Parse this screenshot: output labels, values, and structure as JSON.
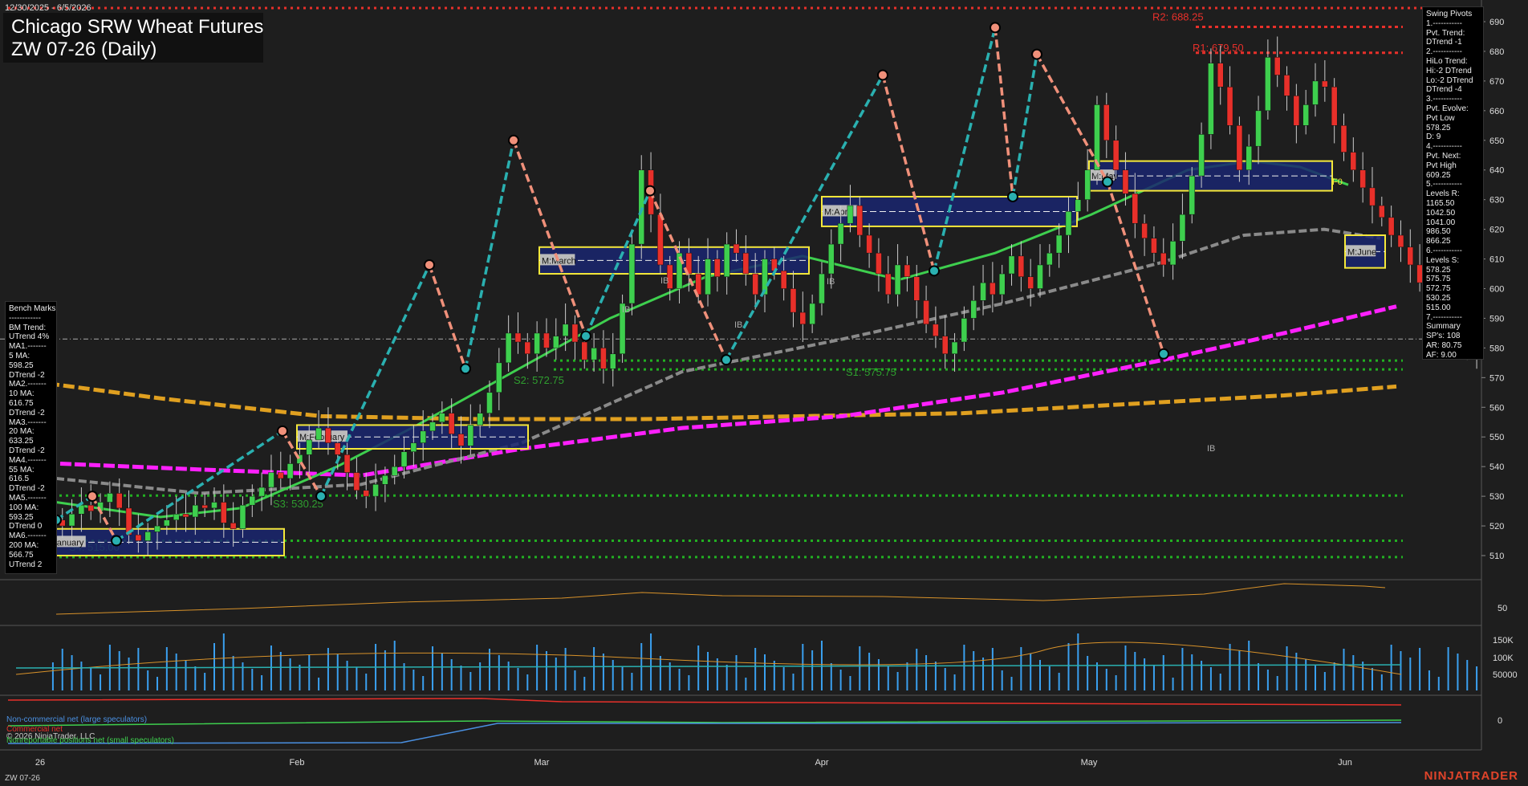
{
  "header": {
    "date_range": "12/30/2025 - 6/5/2026",
    "title": "Chicago SRW Wheat Futures",
    "subtitle": "ZW 07-26 (Daily)"
  },
  "bench_marks": {
    "text": "Bench Marks\n------------\nBM Trend:\nUTrend 4%\nMA1.-------\n5 MA:\n598.25\nDTrend -2\nMA2.-------\n10 MA:\n616.75\nDTrend -2\nMA3.-------\n20 MA:\n633.25\nDTrend -2\nMA4.-------\n55 MA:\n616.5\nDTrend -2\nMA5.-------\n100 MA:\n593.25\nDTrend 0\nMA6.-------\n200 MA:\n566.75\nUTrend 2"
  },
  "swing_pivots": {
    "text": "Swing Pivots\n1.-----------\nPvt. Trend:\nDTrend -1\n2.-----------\nHiLo Trend:\nHi:-2 DTrend\nLo:-2 DTrend\nDTrend -4\n3.-----------\nPvt. Evolve:\nPvt Low\n578.25\nD: 9\n4.-----------\nPvt. Next:\nPvt High\n609.25\n5.-----------\nLevels R:\n1165.50\n1042.50\n1041.00\n986.50\n866.25\n6.-----------\nLevels S:\n578.25\n575.75\n572.75\n530.25\n515.00\n7.-----------\nSummary\nSP's: 108\nAR: 80.75\nAF: 9.00"
  },
  "legend": {
    "noncommercial": "Non-commercial net (large speculators)",
    "commercial": "Commercial net",
    "copyright": "© 2026 NinjaTrader, LLC",
    "nonreportable": "Nonreportable positions net (small speculators)"
  },
  "footer": {
    "symbol": "ZW 07-26",
    "brand": "NINJATRADER"
  },
  "colors": {
    "up": "#3ecf4e",
    "down": "#e8302a",
    "ma_fast": "#3ecf4e",
    "ma_mid": "#8a8a8a",
    "ma_slow": "#ff20ff",
    "ma_200": "#e0a020",
    "swing_up": "#2ab0b0",
    "swing_down": "#f0907a",
    "volume": "#3aa0f0"
  },
  "chart_data": {
    "type": "candlestick",
    "y_axis_ticks": [
      510,
      520,
      530,
      540,
      550,
      560,
      570,
      580,
      590,
      600,
      610,
      620,
      630,
      640,
      650,
      660,
      670,
      680,
      690
    ],
    "ylim": [
      501,
      695
    ],
    "x_axis_labels": [
      "26",
      "Feb",
      "Mar",
      "Apr",
      "May",
      "Jun"
    ],
    "oscillator_ticks": [
      "50"
    ],
    "volume_ticks": [
      "150K",
      "100K",
      "50000"
    ],
    "cot_ticks": [
      "0"
    ],
    "resistance_labels": [
      {
        "label": "R2: 688.25",
        "value": 688.25
      },
      {
        "label": "R1: 679.50",
        "value": 679.5
      }
    ],
    "support_labels": [
      {
        "label": "S1: 575.75",
        "value": 575.75
      },
      {
        "label": "S2: 572.75",
        "value": 572.75
      },
      {
        "label": "S3: 530.25",
        "value": 530.25
      },
      {
        "label": "S4: 515.00",
        "value": 515.0
      }
    ],
    "monthly_boxes": [
      {
        "label": "M:January",
        "low": 510,
        "high": 519
      },
      {
        "label": "M:February",
        "low": 546,
        "high": 554
      },
      {
        "label": "M:March",
        "low": 605,
        "high": 614
      },
      {
        "label": "M:April",
        "low": 621,
        "high": 631
      },
      {
        "label": "M:May",
        "low": 633,
        "high": 643
      },
      {
        "label": "M:June",
        "low": 607,
        "high": 618
      }
    ],
    "fib_label": "F0",
    "inside_bar_label": "IB",
    "closes": [
      522,
      520,
      524,
      527,
      525,
      528,
      531,
      526,
      517,
      515,
      518,
      520,
      522,
      524,
      523,
      527,
      526,
      528,
      521,
      519,
      527,
      530,
      533,
      538,
      536,
      541,
      544,
      549,
      553,
      548,
      544,
      538,
      532,
      530,
      534,
      537,
      540,
      545,
      548,
      552,
      555,
      558,
      551,
      547,
      554,
      558,
      565,
      575,
      585,
      582,
      578,
      585,
      580,
      584,
      588,
      582,
      576,
      580,
      573,
      578,
      595,
      615,
      640,
      625,
      608,
      600,
      612,
      605,
      598,
      610,
      604,
      615,
      612,
      605,
      598,
      610,
      606,
      600,
      592,
      588,
      595,
      605,
      615,
      622,
      628,
      618,
      612,
      605,
      598,
      608,
      604,
      596,
      588,
      584,
      578,
      582,
      590,
      596,
      602,
      598,
      605,
      611,
      604,
      600,
      608,
      612,
      618,
      626,
      630,
      640,
      662,
      650,
      640,
      632,
      622,
      617,
      612,
      608,
      616,
      625,
      638,
      652,
      676,
      668,
      655,
      640,
      648,
      660,
      678,
      672,
      665,
      655,
      662,
      670,
      668,
      655,
      646,
      640,
      634,
      628,
      624,
      618,
      614,
      608,
      602,
      596,
      592,
      586,
      583,
      580,
      578
    ]
  }
}
